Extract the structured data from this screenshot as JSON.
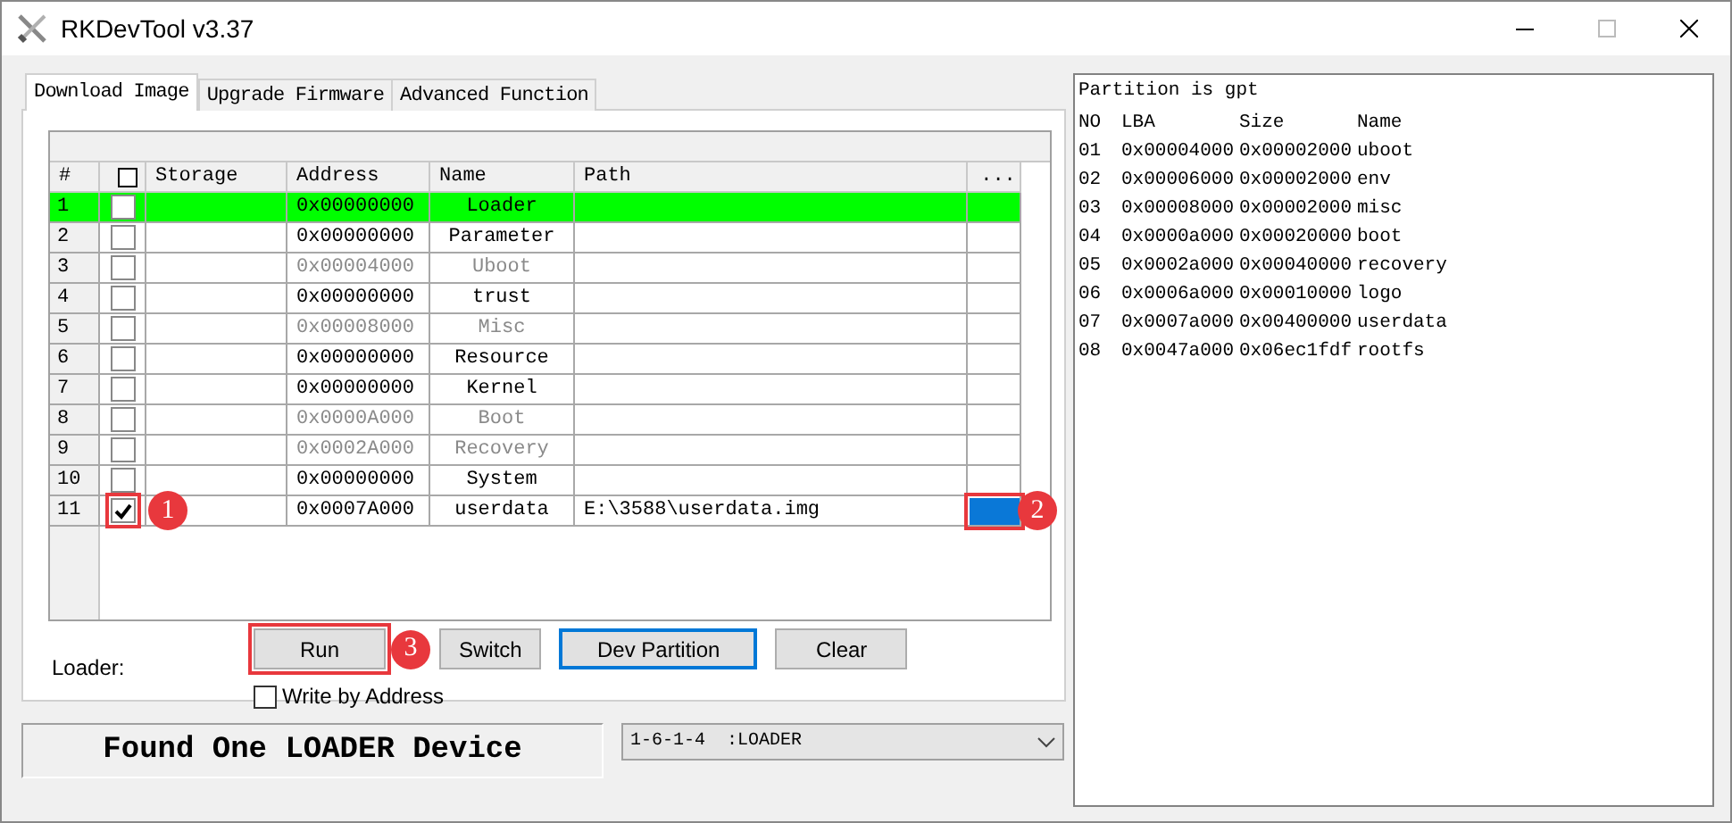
{
  "window": {
    "title": "RKDevTool v3.37"
  },
  "tabs": [
    {
      "label": "Download Image",
      "selected": true
    },
    {
      "label": "Upgrade Firmware",
      "selected": false
    },
    {
      "label": "Advanced Function",
      "selected": false
    }
  ],
  "table": {
    "columns": [
      "#",
      "Storage",
      "Address",
      "Name",
      "Path",
      "..."
    ],
    "rows": [
      {
        "no": "1",
        "checked": false,
        "storage": "",
        "address": "0x00000000",
        "name": "Loader",
        "path": "",
        "enabled": true,
        "selected": true
      },
      {
        "no": "2",
        "checked": false,
        "storage": "",
        "address": "0x00000000",
        "name": "Parameter",
        "path": "",
        "enabled": true,
        "selected": false
      },
      {
        "no": "3",
        "checked": false,
        "storage": "",
        "address": "0x00004000",
        "name": "Uboot",
        "path": "",
        "enabled": false,
        "selected": false
      },
      {
        "no": "4",
        "checked": false,
        "storage": "",
        "address": "0x00000000",
        "name": "trust",
        "path": "",
        "enabled": true,
        "selected": false
      },
      {
        "no": "5",
        "checked": false,
        "storage": "",
        "address": "0x00008000",
        "name": "Misc",
        "path": "",
        "enabled": false,
        "selected": false
      },
      {
        "no": "6",
        "checked": false,
        "storage": "",
        "address": "0x00000000",
        "name": "Resource",
        "path": "",
        "enabled": true,
        "selected": false
      },
      {
        "no": "7",
        "checked": false,
        "storage": "",
        "address": "0x00000000",
        "name": "Kernel",
        "path": "",
        "enabled": true,
        "selected": false
      },
      {
        "no": "8",
        "checked": false,
        "storage": "",
        "address": "0x0000A000",
        "name": "Boot",
        "path": "",
        "enabled": false,
        "selected": false
      },
      {
        "no": "9",
        "checked": false,
        "storage": "",
        "address": "0x0002A000",
        "name": "Recovery",
        "path": "",
        "enabled": false,
        "selected": false
      },
      {
        "no": "10",
        "checked": false,
        "storage": "",
        "address": "0x00000000",
        "name": "System",
        "path": "",
        "enabled": true,
        "selected": false
      },
      {
        "no": "11",
        "checked": true,
        "storage": "",
        "address": "0x0007A000",
        "name": "userdata",
        "path": "E:\\3588\\userdata.img",
        "enabled": true,
        "selected": false,
        "checkbox_marker": "1",
        "browse_marker": "2",
        "browse_focused": true
      }
    ]
  },
  "loader_label": "Loader:",
  "buttons": [
    {
      "label": "Run",
      "focused": false,
      "marker": "3"
    },
    {
      "label": "Switch",
      "focused": false
    },
    {
      "label": "Dev Partition",
      "focused": true
    },
    {
      "label": "Clear",
      "focused": false
    }
  ],
  "write_by_address": {
    "label": "Write by Address",
    "checked": false
  },
  "status": "Found One LOADER Device",
  "device_select": {
    "value": "1-6-1-4  :LOADER"
  },
  "partition_log": {
    "title": "Partition is gpt",
    "columns": [
      "NO",
      "LBA",
      "Size",
      "Name"
    ],
    "rows": [
      [
        "01",
        "0x00004000",
        "0x00002000",
        "uboot"
      ],
      [
        "02",
        "0x00006000",
        "0x00002000",
        "env"
      ],
      [
        "03",
        "0x00008000",
        "0x00002000",
        "misc"
      ],
      [
        "04",
        "0x0000a000",
        "0x00020000",
        "boot"
      ],
      [
        "05",
        "0x0002a000",
        "0x00040000",
        "recovery"
      ],
      [
        "06",
        "0x0006a000",
        "0x00010000",
        "logo"
      ],
      [
        "07",
        "0x0007a000",
        "0x00400000",
        "userdata"
      ],
      [
        "08",
        "0x0047a000",
        "0x06ec1fdf",
        "rootfs"
      ]
    ]
  }
}
